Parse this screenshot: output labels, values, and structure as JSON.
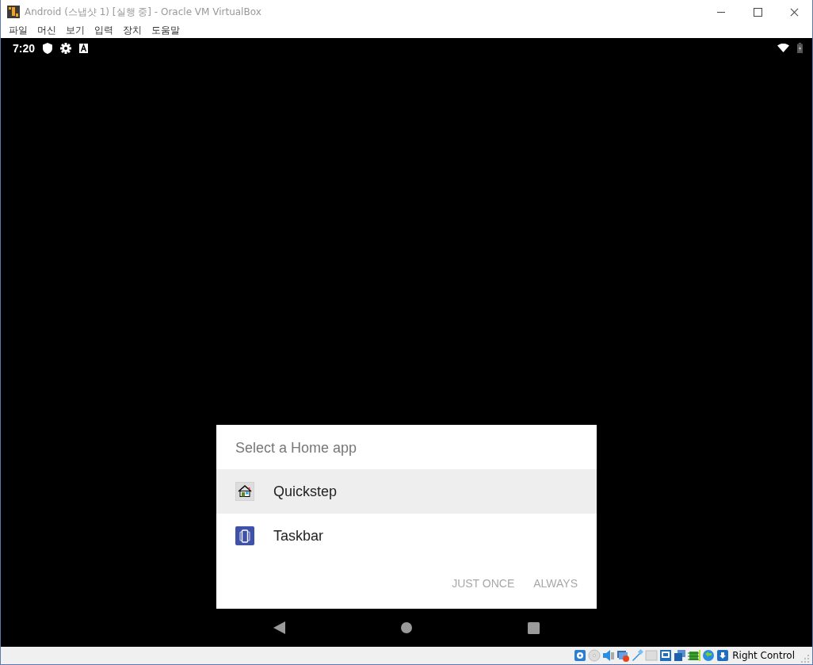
{
  "window": {
    "title": "Android (스냅샷 1) [실행 중] - Oracle VM VirtualBox"
  },
  "menu": [
    "파일",
    "머신",
    "보기",
    "입력",
    "장치",
    "도움말"
  ],
  "android_status_bar": {
    "time": "7:20"
  },
  "dialog": {
    "title": "Select a Home app",
    "apps": [
      {
        "name": "Quickstep",
        "kind": "house",
        "selected": true
      },
      {
        "name": "Taskbar",
        "kind": "taskbar",
        "selected": false
      }
    ],
    "buttons": [
      {
        "label": "JUST ONCE",
        "disabled": true
      },
      {
        "label": "ALWAYS",
        "disabled": true
      }
    ]
  },
  "host_status_bar": {
    "host_key": "Right Control"
  }
}
